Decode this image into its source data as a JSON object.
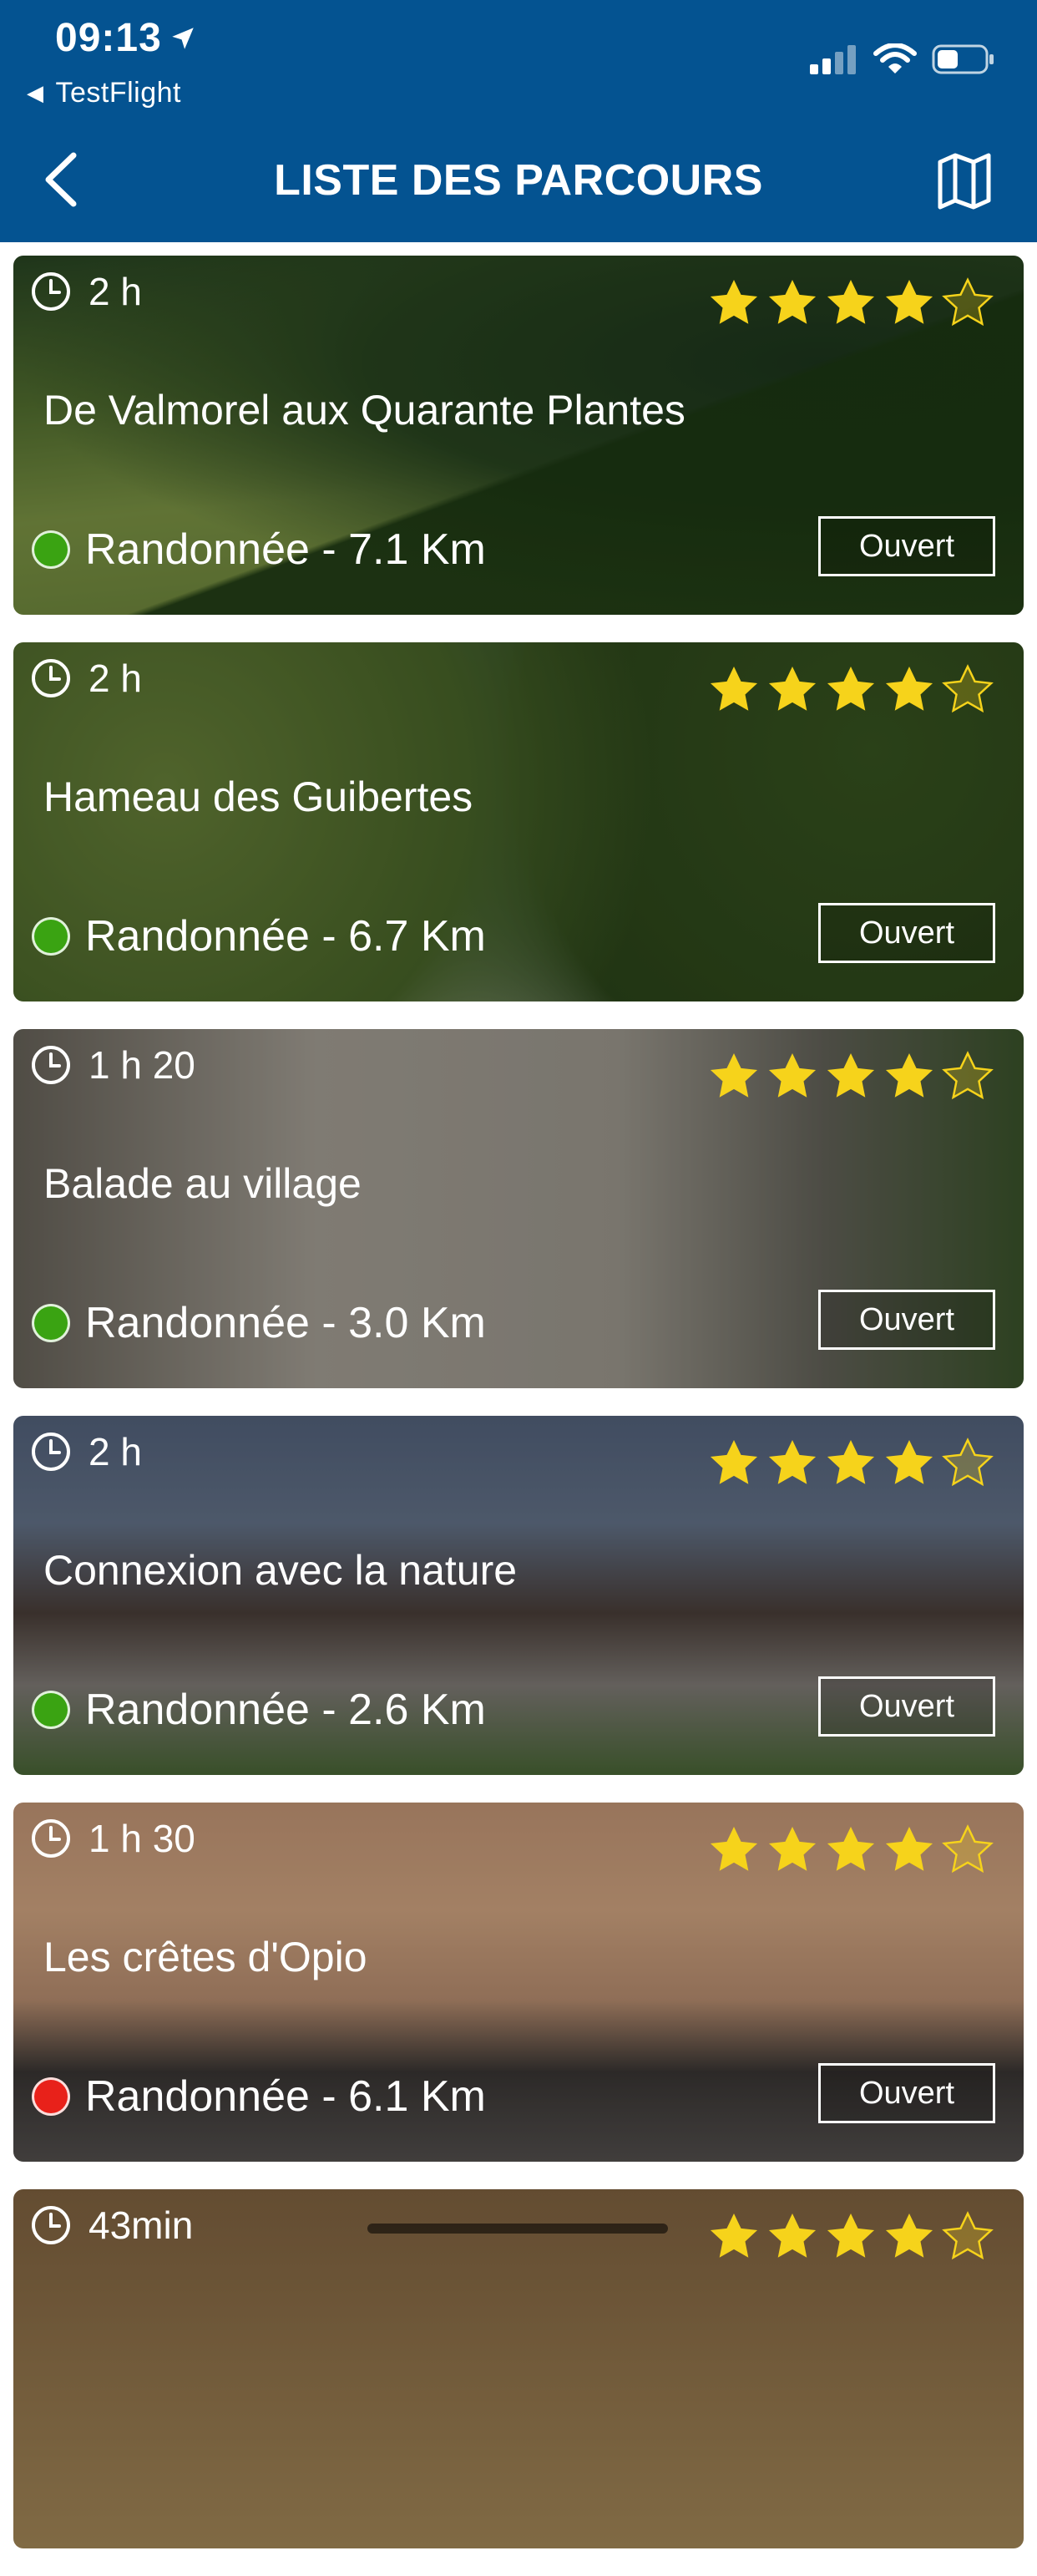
{
  "status_bar": {
    "time": "09:13",
    "back_app": "TestFlight"
  },
  "nav": {
    "title": "LISTE DES PARCOURS"
  },
  "colors": {
    "header": "#045391",
    "star": "#f6d31b",
    "easy": "#3aa312",
    "hard": "#e8211a"
  },
  "routes": [
    {
      "duration": "2 h",
      "name": "De Valmorel aux Quarante Plantes",
      "meta": "Randonnée - 7.1 Km",
      "difficulty_color": "#3aa312",
      "status": "Ouvert",
      "rating": 4
    },
    {
      "duration": "2 h",
      "name": "Hameau des Guibertes",
      "meta": "Randonnée - 6.7 Km",
      "difficulty_color": "#3aa312",
      "status": "Ouvert",
      "rating": 4
    },
    {
      "duration": "1 h 20",
      "name": "Balade au village",
      "meta": "Randonnée - 3.0 Km",
      "difficulty_color": "#3aa312",
      "status": "Ouvert",
      "rating": 4
    },
    {
      "duration": "2 h",
      "name": "Connexion avec la nature",
      "meta": "Randonnée - 2.6 Km",
      "difficulty_color": "#3aa312",
      "status": "Ouvert",
      "rating": 4
    },
    {
      "duration": "1 h 30",
      "name": "Les crêtes d'Opio",
      "meta": "Randonnée - 6.1 Km",
      "difficulty_color": "#e8211a",
      "status": "Ouvert",
      "rating": 4
    },
    {
      "duration": "43min",
      "rating": 4
    }
  ]
}
